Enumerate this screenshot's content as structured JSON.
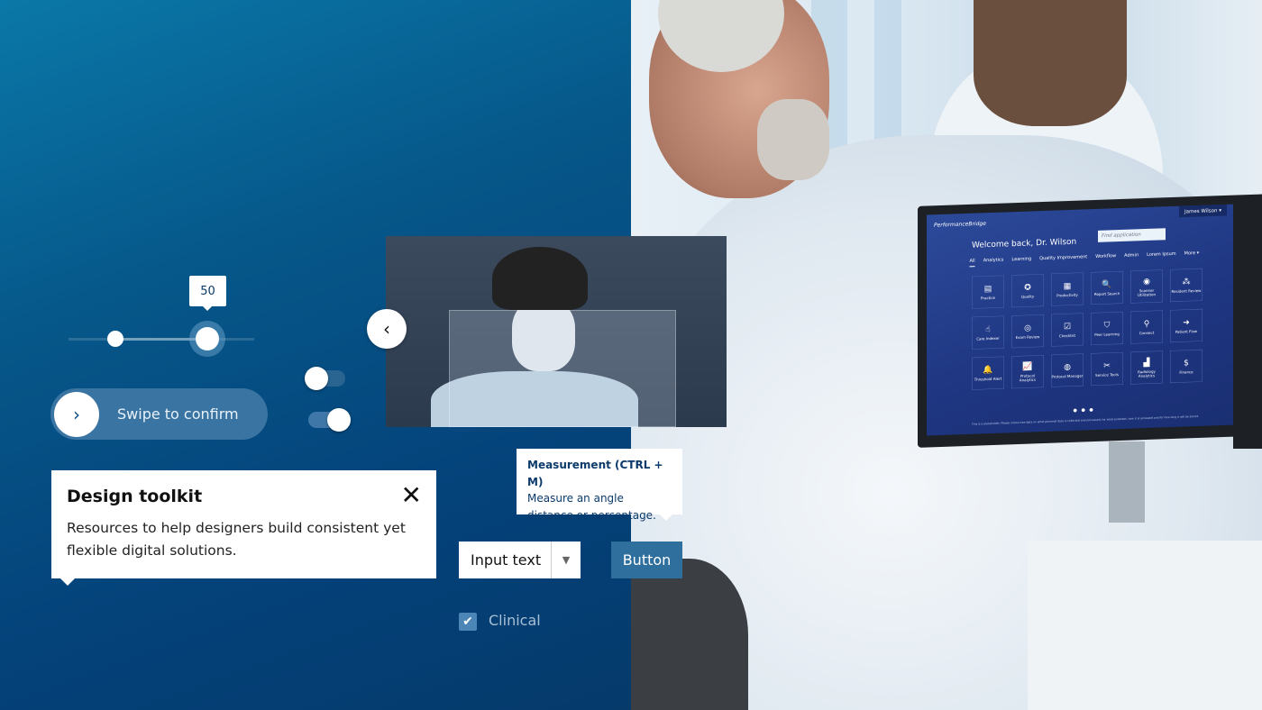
{
  "slider": {
    "value_label": "50",
    "value": 50,
    "thumbs": 2
  },
  "swipe": {
    "label": "Swipe to confirm",
    "icon": "chevron-right-icon"
  },
  "toggles": [
    {
      "state": "off"
    },
    {
      "state": "on"
    }
  ],
  "card": {
    "title": "Design toolkit",
    "body": "Resources to help designers build consistent yet flexible digital solutions.",
    "close_icon": "close-icon"
  },
  "tooltip": {
    "title": "Measurement (CTRL + M)",
    "body": "Measure an angle distance or percentage."
  },
  "input": {
    "value": "Input text",
    "icon": "caret-down-icon"
  },
  "button": {
    "label": "Button"
  },
  "checkbox": {
    "label": "Clinical",
    "checked": true
  },
  "video": {
    "back_icon": "chevron-left-icon"
  },
  "monitor": {
    "brand": "PerformanceBridge",
    "user": "James Wilson ▾",
    "welcome": "Welcome back, Dr. Wilson",
    "search_placeholder": "Find application",
    "tabs": [
      "All",
      "Analytics",
      "Learning",
      "Quality Improvement",
      "Workflow",
      "Admin",
      "Lorem Ipsum",
      "More ▾"
    ],
    "apps": [
      {
        "label": "Practice",
        "icon": "▤"
      },
      {
        "label": "Quality",
        "icon": "✪"
      },
      {
        "label": "Productivity",
        "icon": "▦"
      },
      {
        "label": "Report Search",
        "icon": "🔍"
      },
      {
        "label": "Scanner Utilization",
        "icon": "◉"
      },
      {
        "label": "Resident Review",
        "icon": "⁂"
      },
      {
        "label": "Care Indexer",
        "icon": "☝"
      },
      {
        "label": "Exam Review",
        "icon": "◎"
      },
      {
        "label": "Checklist",
        "icon": "☑"
      },
      {
        "label": "Peer Learning",
        "icon": "⛉"
      },
      {
        "label": "Connect",
        "icon": "⚲"
      },
      {
        "label": "Patient Flow",
        "icon": "➜"
      },
      {
        "label": "Threshold Alert",
        "icon": "🔔"
      },
      {
        "label": "Protocol Analytics",
        "icon": "📈"
      },
      {
        "label": "Protocol Manager",
        "icon": "◍"
      },
      {
        "label": "Service Tools",
        "icon": "✂"
      },
      {
        "label": "Radiology Analytics",
        "icon": "▟"
      },
      {
        "label": "Finance",
        "icon": "$"
      }
    ],
    "pager": "● ● ●",
    "footer": "This is a placeholder. Please notice new data on what personal data is collected and processed, for what purposes, how it is accessed and for how long it will be stored."
  },
  "colors": {
    "accent": "#2e6f9e",
    "bg_top": "#0a78a8",
    "bg_bottom": "#053a6b"
  }
}
